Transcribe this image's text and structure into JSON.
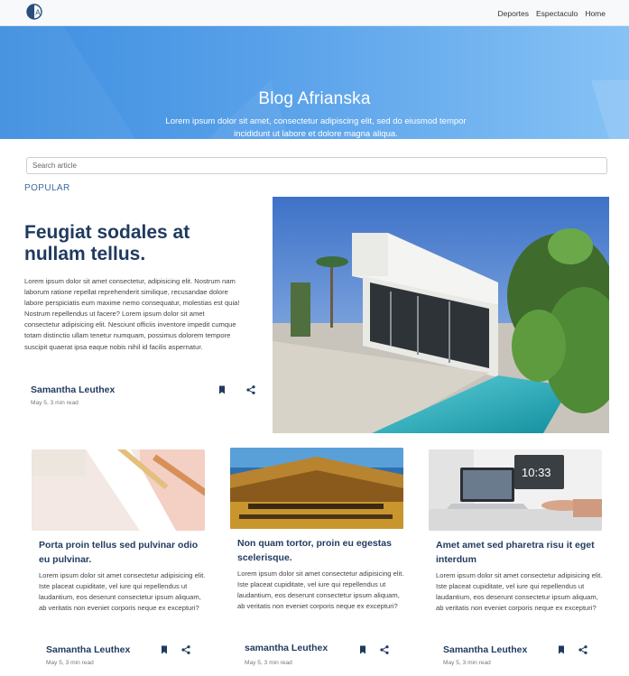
{
  "navbar": {
    "logo_icon": "logo-circle-a-icon",
    "links": [
      "Deportes",
      "Espectaculo",
      "Home"
    ]
  },
  "hero": {
    "title": "Blog Afrianska",
    "subtitle": "Lorem ipsum dolor sit amet, consectetur adipiscing elit, sed do eiusmod tempor incididunt ut labore et dolore magna aliqua."
  },
  "search": {
    "placeholder": "Search article"
  },
  "popular_label": "POPULAR",
  "featured": {
    "title": "Feugiat sodales at nullam tellus.",
    "body": "Lorem ipsum dolor sit amet consectetur, adipisicing elit. Nostrum nam laborum ratione repellat reprehenderit similique, recusandae dolore labore perspiciatis eum maxime nemo consequatur, molestias est quia! Nostrum repellendus ut facere? Lorem ipsum dolor sit amet consectetur adipisicing elit. Nesciunt officiis inventore impedit cumque totam distinctio ullam tenetur numquam, possimus dolorem tempore suscipit quaerat ipsa eaque nobis nihil id facilis aspernatur.",
    "author": "Samantha Leuthex",
    "meta": "May 5, 3 min read",
    "image_alt": "modern white house with pool"
  },
  "cards": [
    {
      "title": "Porta proin tellus sed pulvinar odio eu pulvinar.",
      "body": "Lorem ipsum dolor sit amet consectetur adipisicing elit. Iste placeat cupiditate, vel iure qui repellendus ut laudantium, eos deserunt consectetur ipsum aliquam, ab veritatis non eveniet corporis neque ex excepturi?",
      "author": "Samantha Leuthex",
      "meta": "May 5, 3 min read"
    },
    {
      "title": "Non quam tortor, proin eu egestas scelerisque.",
      "body": "Lorem ipsum dolor sit amet consectetur adipisicing elit. Iste placeat cupiditate, vel iure qui repellendus ut laudantium, eos deserunt consectetur ipsum aliquam, ab veritatis non eveniet corporis neque ex excepturi?",
      "author": "samantha Leuthex",
      "meta": "May 5, 3 min read"
    },
    {
      "title": "Amet amet sed pharetra risu it eget interdum",
      "body": "Lorem ipsum dolor sit amet consectetur adipisicing elit. Iste placeat cupiditate, vel iure qui repellendus ut laudantium, eos deserunt consectetur ipsum aliquam, ab veritatis non eveniet corporis neque ex excepturi?",
      "author": "Samantha Leuthex",
      "meta": "May 5, 3 min read"
    }
  ],
  "icons": {
    "bookmark": "bookmark-icon",
    "share": "share-icon"
  },
  "colors": {
    "accent": "#1f3a5f",
    "hero_start": "#3f8fe0",
    "hero_end": "#86c2f5",
    "link": "#3b6aa0"
  }
}
